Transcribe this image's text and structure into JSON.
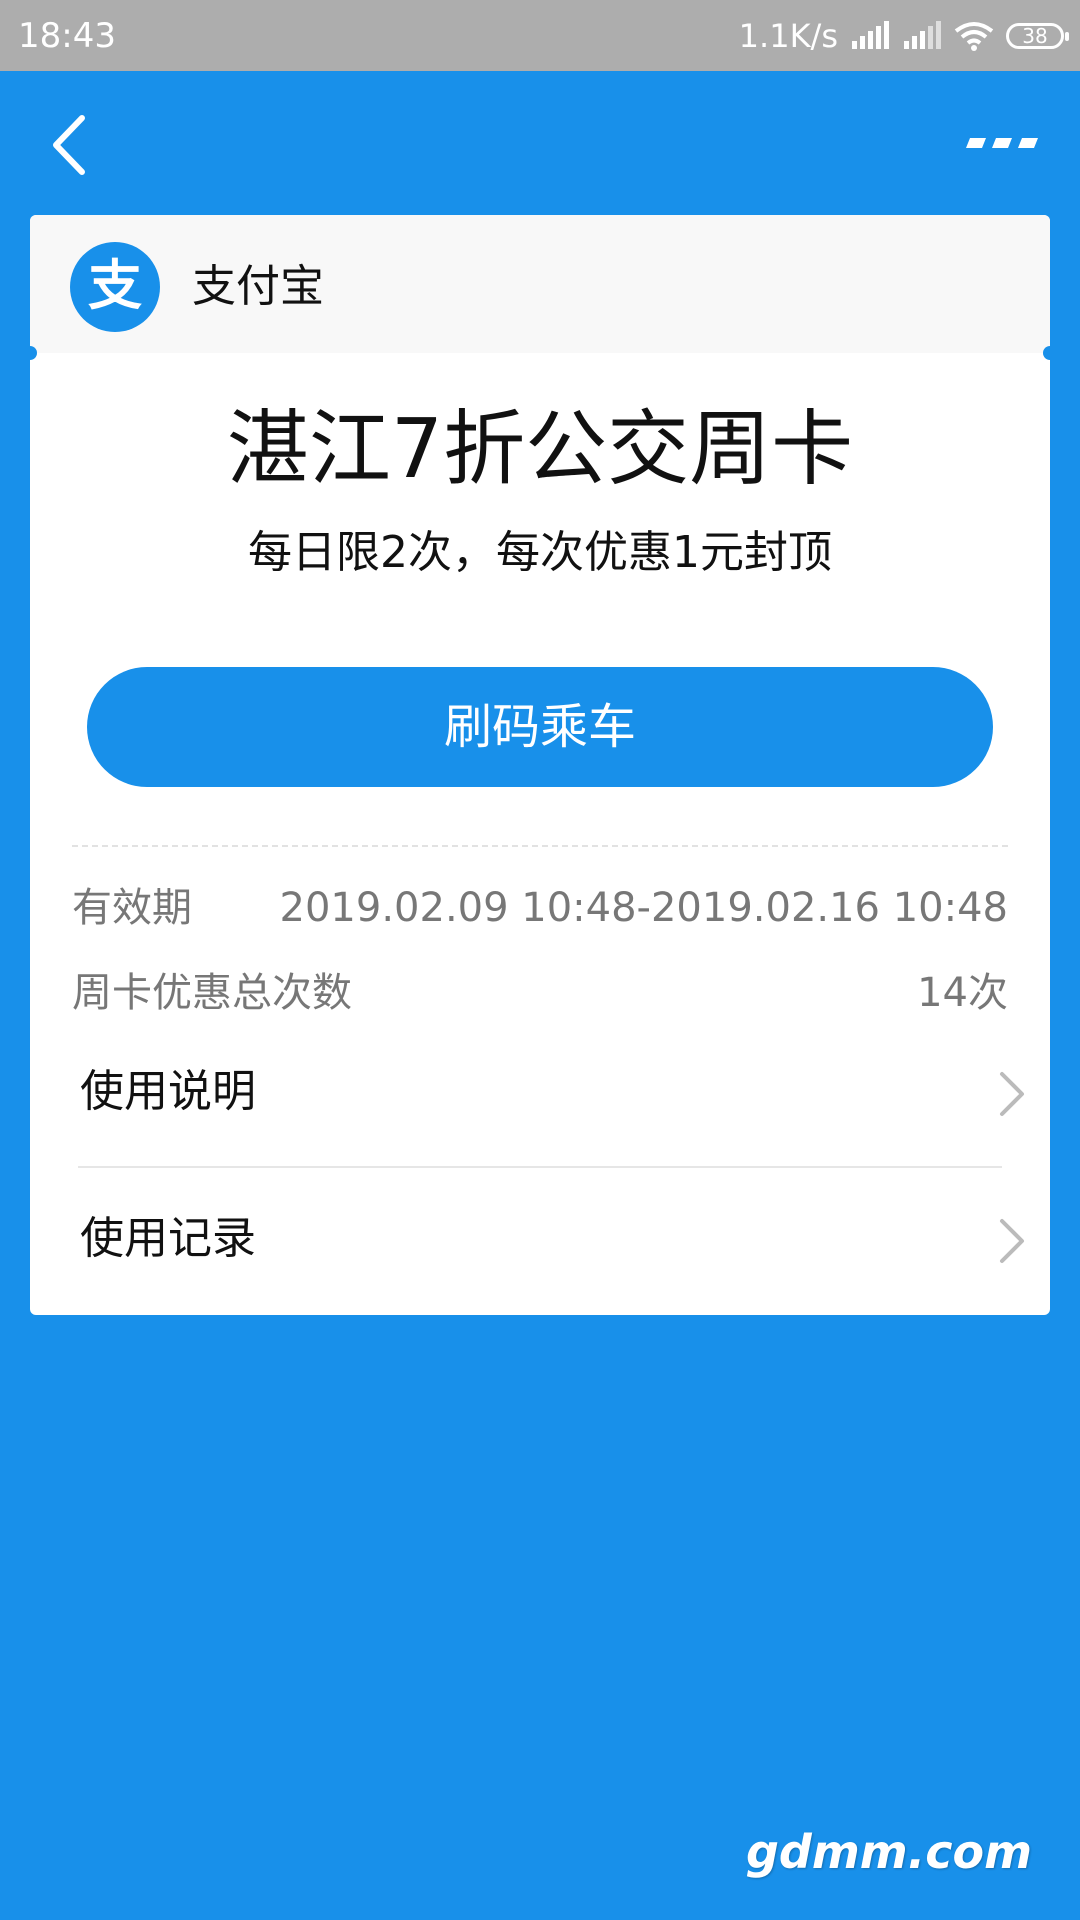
{
  "status_bar": {
    "time": "18:43",
    "net_speed": "1.1K/s",
    "battery": "38",
    "icons": [
      "signal-icon",
      "signal-icon",
      "wifi-icon",
      "battery-icon"
    ]
  },
  "nav": {
    "back_icon": "chevron-left-icon",
    "more_icon": "more-dots-icon"
  },
  "card": {
    "app_name": "支付宝",
    "logo_char": "支",
    "title": "湛江7折公交周卡",
    "subtitle": "每日限2次，每次优惠1元封顶",
    "ride_button": "刷码乘车",
    "validity_label": "有效期",
    "validity_value": "2019.02.09 10:48-2019.02.16 10:48",
    "count_label": "周卡优惠总次数",
    "count_value": "14次",
    "items": [
      {
        "label": "使用说明"
      },
      {
        "label": "使用记录"
      }
    ]
  },
  "watermark": "gdmm.com",
  "colors": {
    "primary": "#1890EA",
    "status_bar": "#ADADAD",
    "card_header": "#F8F8F8",
    "muted_text": "#777777"
  }
}
